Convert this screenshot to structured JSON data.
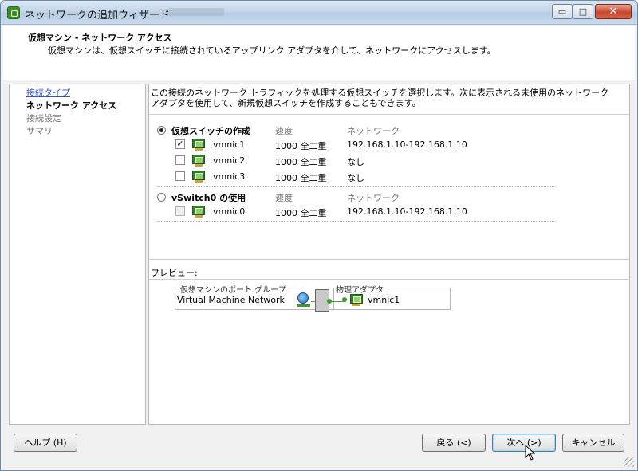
{
  "window": {
    "title": "ネットワークの追加ウィザード",
    "min_glyph": "▭",
    "max_glyph": "□",
    "close_glyph": "✕"
  },
  "header": {
    "title": "仮想マシン - ネットワーク アクセス",
    "description": "仮想マシンは、仮想スイッチに接続されているアップリンク アダプタを介して、ネットワークにアクセスします。"
  },
  "steps": [
    {
      "label": "接続タイプ",
      "state": "link"
    },
    {
      "label": "ネットワーク アクセス",
      "state": "current"
    },
    {
      "label": "接続設定",
      "state": "disabled"
    },
    {
      "label": "サマリ",
      "state": "disabled"
    }
  ],
  "instructions": "この接続のネットワーク トラフィックを処理する仮想スイッチを選択します。次に表示される未使用のネットワーク アダプタを使用して、新規仮想スイッチを作成することもできます。",
  "groups": {
    "create": {
      "title": "仮想スイッチの作成",
      "speed_header": "速度",
      "network_header": "ネットワーク",
      "selected": true,
      "adapters": [
        {
          "name": "vmnic1",
          "speed": "1000 全二重",
          "network": "192.168.1.10-192.168.1.10",
          "checked": true
        },
        {
          "name": "vmnic2",
          "speed": "1000 全二重",
          "network": "なし",
          "checked": false
        },
        {
          "name": "vmnic3",
          "speed": "1000 全二重",
          "network": "なし",
          "checked": false
        }
      ]
    },
    "existing": {
      "title": "vSwitch0 の使用",
      "speed_header": "速度",
      "network_header": "ネットワーク",
      "selected": false,
      "adapters": [
        {
          "name": "vmnic0",
          "speed": "1000 全二重",
          "network": "192.168.1.10-192.168.1.10",
          "checked": false
        }
      ]
    }
  },
  "preview": {
    "label": "プレビュー:",
    "portgroup_legend": "仮想マシンのポート グループ",
    "portgroup_name": "Virtual Machine Network",
    "adapter_legend": "物理アダプタ",
    "adapter_name": "vmnic1"
  },
  "buttons": {
    "help": "ヘルプ (H)",
    "back": "戻る (<)",
    "next": "次へ (>)",
    "cancel": "キャンセル"
  },
  "icons": {
    "app": "wizard-icon",
    "adapter": "network-adapter-icon",
    "vm": "virtual-machine-icon",
    "switch": "vswitch-icon"
  }
}
